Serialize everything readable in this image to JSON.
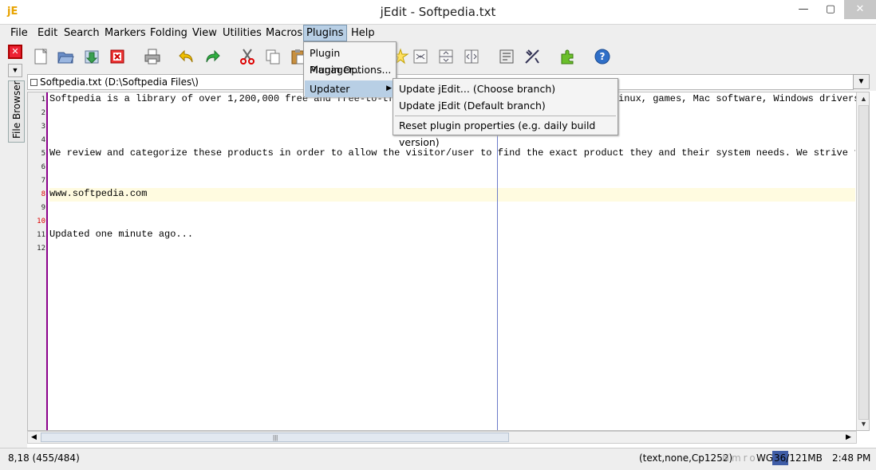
{
  "window": {
    "title": "jEdit - Softpedia.txt",
    "app_icon": "jE",
    "minimize_glyph": "—",
    "maximize_glyph": "▢",
    "close_glyph": "✕"
  },
  "menubar": [
    {
      "label": "File"
    },
    {
      "label": "Edit"
    },
    {
      "label": "Search"
    },
    {
      "label": "Markers"
    },
    {
      "label": "Folding"
    },
    {
      "label": "View"
    },
    {
      "label": "Utilities"
    },
    {
      "label": "Macros"
    },
    {
      "label": "Plugins"
    },
    {
      "label": "Help"
    }
  ],
  "sidebar": {
    "file_browser_label": "File Browser",
    "close_glyph": "✕",
    "dropdown_glyph": "▼"
  },
  "toolbar_icons": [
    "new-file-icon",
    "open-file-icon",
    "reload-icon",
    "close-file-icon",
    "print-icon",
    "undo-icon",
    "redo-icon",
    "cut-icon",
    "copy-icon",
    "paste-icon",
    "star-icon",
    "fold-icon",
    "split-horizontal-icon",
    "split-vertical-icon",
    "unsplit-icon",
    "buffer-options-icon",
    "global-options-icon",
    "plugin-manager-icon",
    "help-icon"
  ],
  "buffer": {
    "tab_label": "Softpedia.txt (D:\\Softpedia Files\\)",
    "dropdown_glyph": "▼"
  },
  "editor": {
    "lines": [
      {
        "n": "1",
        "text": "Softpedia is a library of over 1,200,000 free and free-to-try",
        "tail": "inux, games, Mac software, Windows drivers,"
      },
      {
        "n": "2",
        "text": ""
      },
      {
        "n": "3",
        "text": ""
      },
      {
        "n": "4",
        "text": ""
      },
      {
        "n": "5",
        "text": "We review and categorize these products in order to allow the visitor/user to find the exact product they and their system needs. We strive to de"
      },
      {
        "n": "6",
        "text": ""
      },
      {
        "n": "7",
        "text": ""
      },
      {
        "n": "8",
        "text": "www.softpedia.com"
      },
      {
        "n": "9",
        "text": ""
      },
      {
        "n": "10",
        "text": ""
      },
      {
        "n": "11",
        "text": "Updated one minute ago..."
      },
      {
        "n": "12",
        "text": ""
      }
    ],
    "current_line": 8,
    "scroll_up": "▲",
    "scroll_down": "▼",
    "scroll_left": "◀",
    "scroll_right": "▶",
    "hthumb_grip": "|||"
  },
  "plugins_menu": {
    "items": [
      {
        "label": "Plugin Manager..."
      },
      {
        "label": "Plugin Options..."
      },
      {
        "label": "Updater",
        "arrow": "▶"
      }
    ]
  },
  "updater_menu": {
    "items": [
      {
        "label": "Update jEdit... (Choose branch)"
      },
      {
        "label": "Update jEdit (Default branch)"
      },
      {
        "label": "Reset plugin properties (e.g. daily build version)"
      }
    ]
  },
  "statusbar": {
    "caret": "8,18 (455/484)",
    "mode": "(text,none,Cp1252)",
    "flags": "Nmro",
    "wg": "WG",
    "memory": "36/121MB",
    "memory_fraction": 0.3,
    "time": "2:48 PM"
  }
}
